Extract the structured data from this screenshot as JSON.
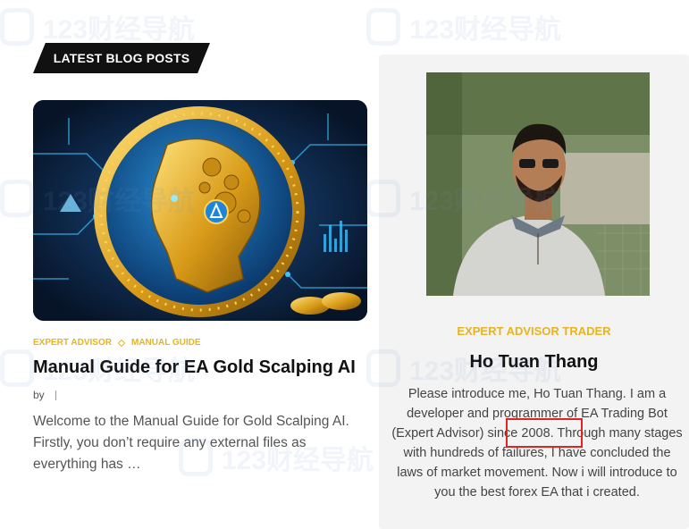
{
  "watermark": {
    "text": "123财经导航"
  },
  "section": {
    "title": "LATEST BLOG POSTS"
  },
  "post": {
    "image_alt": "Golden AI head coin artwork",
    "categories": [
      "EXPERT ADVISOR",
      "MANUAL GUIDE"
    ],
    "title": "Manual Guide for EA Gold Scalping AI",
    "byline": "by",
    "excerpt": "Welcome to the Manual Guide for Gold Scalping AI. Firstly, you don’t require any external files as everything has …"
  },
  "author": {
    "role": "EXPERT ADVISOR TRADER",
    "name": "Ho Tuan Thang",
    "bio": "Please introduce me, Ho Tuan Thang. I am a developer and programmer of EA Trading Bot (Expert Advisor) since 2008. Through many stages with hundreds of failures, I have concluded the laws of market movement. Now i will introduce to you the best forex EA that i created."
  },
  "colors": {
    "accent": "#e6b422",
    "badge_bg": "#111111",
    "highlight": "#e02424",
    "card_bg": "#f3f3f3"
  }
}
